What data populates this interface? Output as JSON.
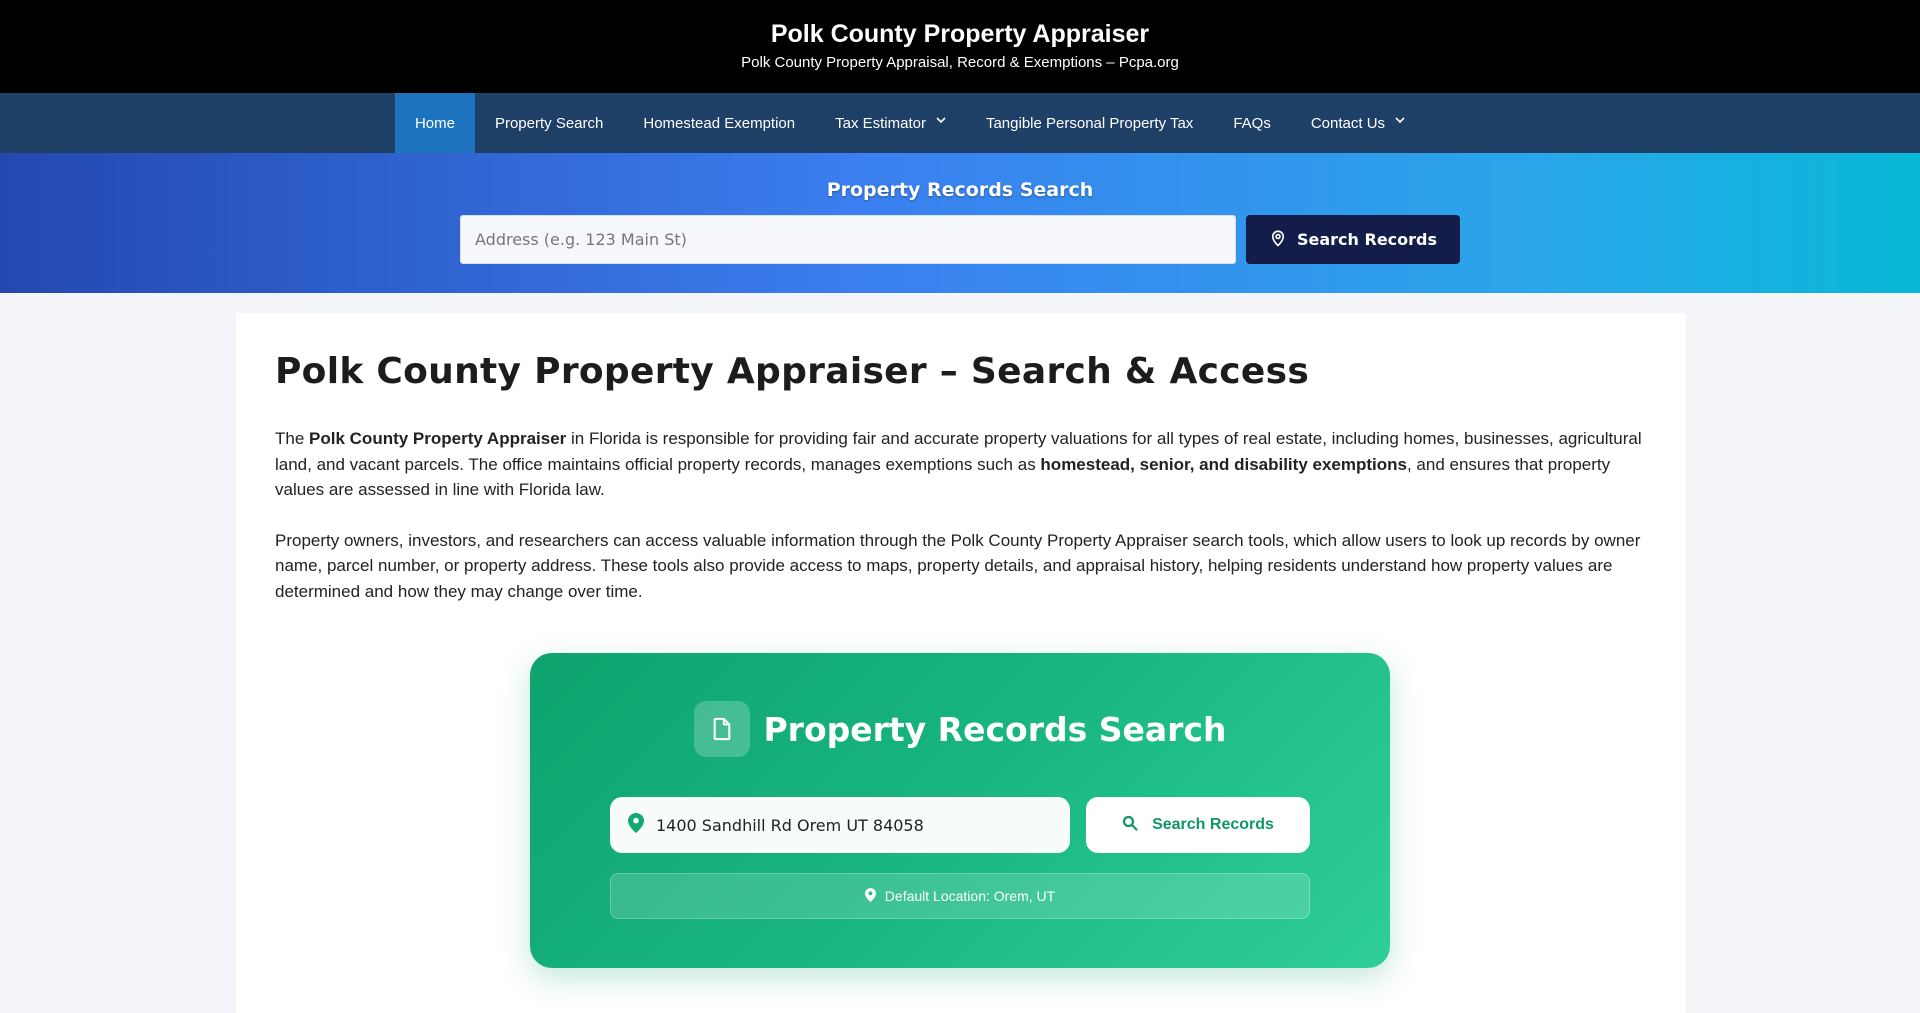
{
  "header": {
    "title": "Polk County Property Appraiser",
    "tagline": "Polk County Property Appraisal, Record & Exemptions – Pcpa.org"
  },
  "nav": {
    "items": [
      {
        "label": "Home",
        "active": true,
        "has_dropdown": false
      },
      {
        "label": "Property Search",
        "active": false,
        "has_dropdown": false
      },
      {
        "label": "Homestead Exemption",
        "active": false,
        "has_dropdown": false
      },
      {
        "label": "Tax Estimator",
        "active": false,
        "has_dropdown": true
      },
      {
        "label": "Tangible Personal Property Tax",
        "active": false,
        "has_dropdown": false
      },
      {
        "label": "FAQs",
        "active": false,
        "has_dropdown": false
      },
      {
        "label": "Contact Us",
        "active": false,
        "has_dropdown": true
      }
    ]
  },
  "hero": {
    "title": "Property Records Search",
    "input_placeholder": "Address (e.g. 123 Main St)",
    "input_value": "",
    "button_label": "Search Records",
    "button_icon": "map-pin-outline-icon"
  },
  "article": {
    "title": "Polk County Property Appraiser – Search & Access",
    "p1": {
      "t1": "The ",
      "b1": "Polk County Property Appraiser",
      "t2": " in Florida is responsible for providing fair and accurate property valuations for all types of real estate, including homes, businesses, agricultural land, and vacant parcels. The office maintains official property records, manages exemptions such as ",
      "b2": "homestead, senior, and disability exemptions",
      "t3": ", and ensures that property values are assessed in line with Florida law."
    },
    "p2": "Property owners, investors, and researchers can access valuable information through the Polk County Property Appraiser search tools, which allow users to look up records by owner name, parcel number, or property address. These tools also provide access to maps, property details, and appraisal history, helping residents understand how property values are determined and how they may change over time."
  },
  "records_card": {
    "title": "Property Records Search",
    "title_icon": "document-icon",
    "input_value": "1400 Sandhill Rd Orem UT 84058",
    "input_icon": "location-pin-icon",
    "button_label": "Search Records",
    "button_icon": "search-icon",
    "default_location": "Default Location: Orem, UT"
  },
  "colors": {
    "header_bg": "#000000",
    "nav_bg": "#1e3f66",
    "nav_active": "#1e73be",
    "hero_btn": "#141d4a",
    "card_green": "#17b47f",
    "card_btn_text": "#13956a"
  }
}
